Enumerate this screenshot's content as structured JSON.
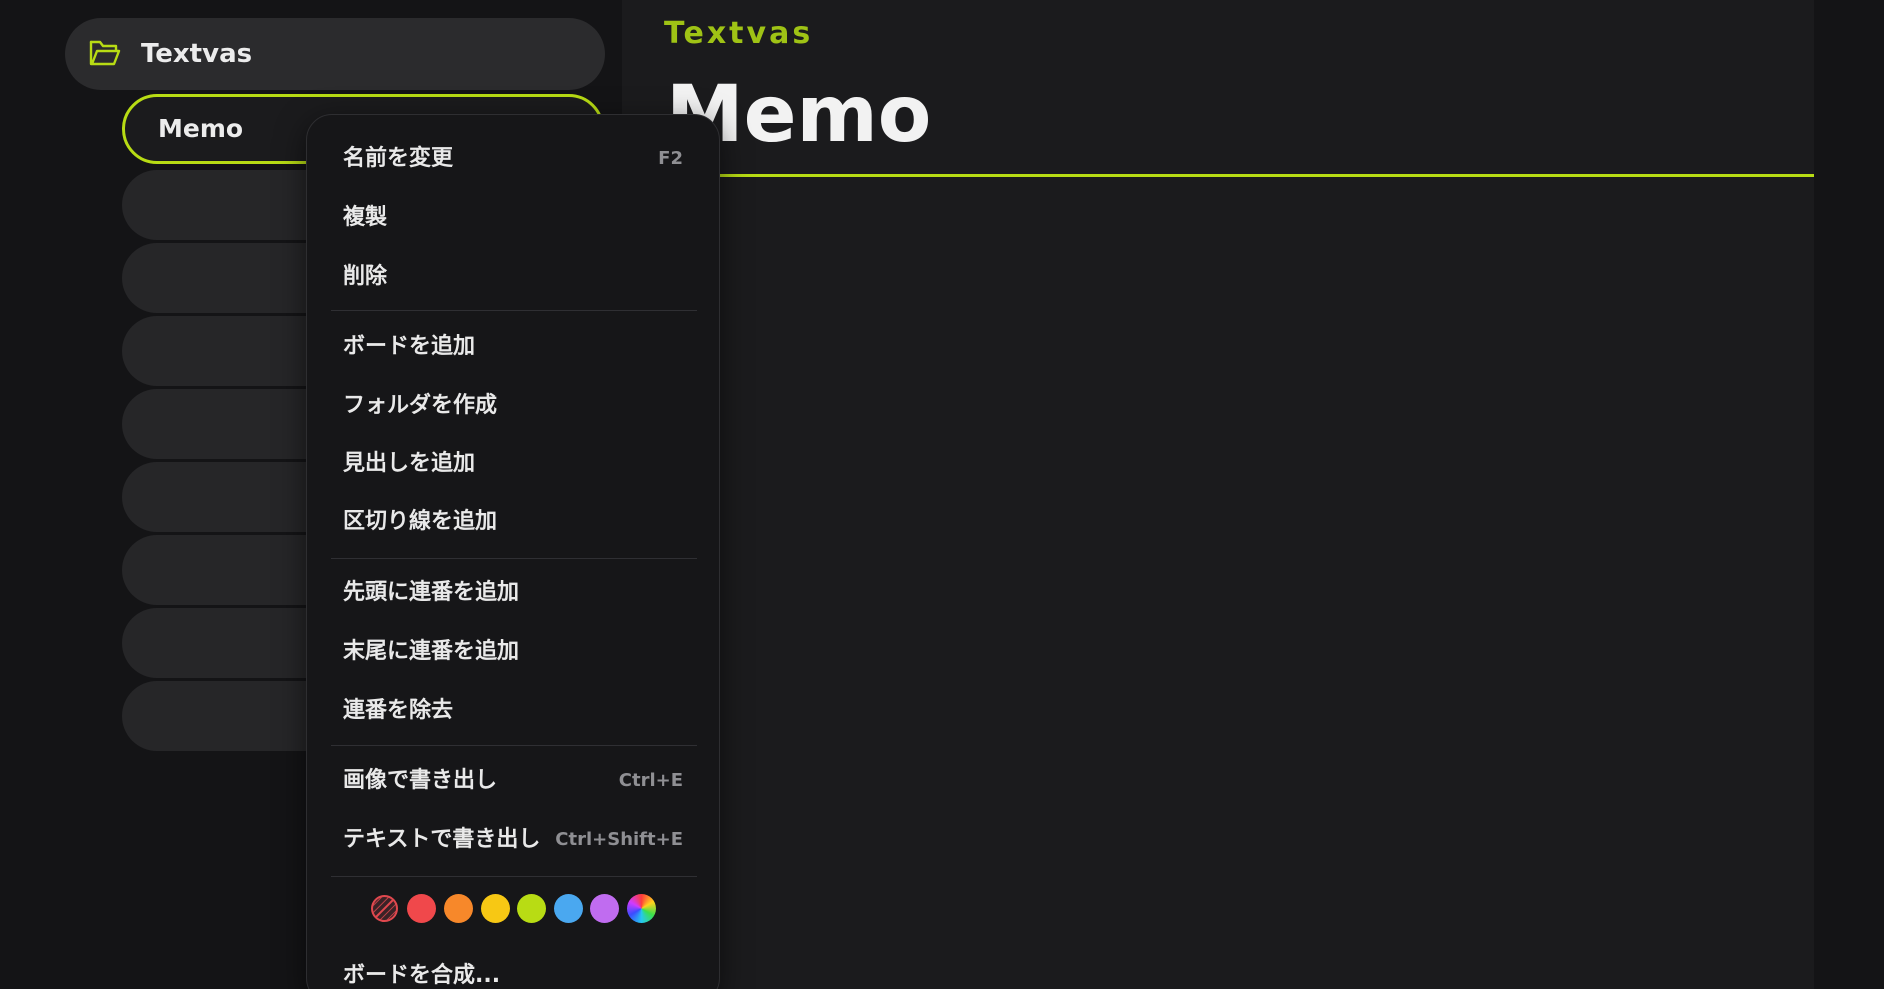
{
  "sidebar": {
    "folder": {
      "label": "Textvas",
      "icon": "folder-open-icon"
    },
    "boards": [
      {
        "label": "Memo",
        "selected": true
      },
      {
        "label": ""
      },
      {
        "label": ""
      },
      {
        "label": ""
      },
      {
        "label": ""
      },
      {
        "label": ""
      },
      {
        "label": ""
      },
      {
        "label": ""
      },
      {
        "label": ""
      }
    ]
  },
  "main": {
    "app_name": "Textvas",
    "board_title": "Memo"
  },
  "context_menu": {
    "items": [
      {
        "label": "名前を変更",
        "shortcut": "F2"
      },
      {
        "label": "複製",
        "shortcut": ""
      },
      {
        "label": "削除",
        "shortcut": ""
      },
      {
        "label": "ボードを追加",
        "shortcut": ""
      },
      {
        "label": "フォルダを作成",
        "shortcut": ""
      },
      {
        "label": "見出しを追加",
        "shortcut": ""
      },
      {
        "label": "区切り線を追加",
        "shortcut": ""
      },
      {
        "label": "先頭に連番を追加",
        "shortcut": ""
      },
      {
        "label": "末尾に連番を追加",
        "shortcut": ""
      },
      {
        "label": "連番を除去",
        "shortcut": ""
      },
      {
        "label": "画像で書き出し",
        "shortcut": "Ctrl+E"
      },
      {
        "label": "テキストで書き出し",
        "shortcut": "Ctrl+Shift+E"
      },
      {
        "label": "ボードを合成...",
        "shortcut": ""
      }
    ],
    "colors": [
      {
        "name": "none",
        "hex": ""
      },
      {
        "name": "red",
        "hex": "#f0484b"
      },
      {
        "name": "orange",
        "hex": "#f7882a"
      },
      {
        "name": "yellow",
        "hex": "#f7c814"
      },
      {
        "name": "lime",
        "hex": "#b8dc14"
      },
      {
        "name": "blue",
        "hex": "#4aa8f0"
      },
      {
        "name": "purple",
        "hex": "#c06cf0"
      },
      {
        "name": "rainbow",
        "hex": ""
      }
    ]
  },
  "theme": {
    "accent": "#b8dc14",
    "app_name_color": "#9fc315",
    "background": "#141416",
    "surface": "#1b1b1d"
  }
}
